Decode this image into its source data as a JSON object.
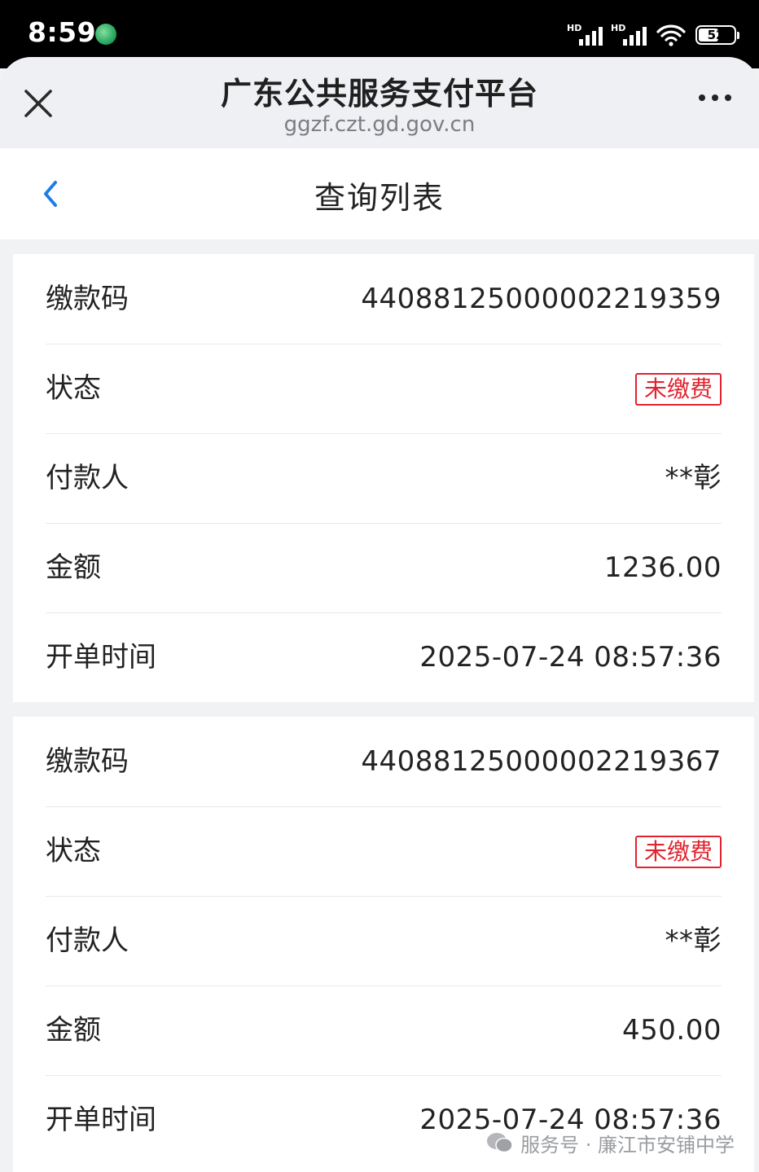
{
  "status_bar": {
    "time": "8:59",
    "battery": "52"
  },
  "browser": {
    "title": "广东公共服务支付平台",
    "url": "ggzf.czt.gd.gov.cn"
  },
  "page": {
    "title": "查询列表"
  },
  "labels": {
    "code": "缴款码",
    "status": "状态",
    "payer": "付款人",
    "amount": "金额",
    "time": "开单时间"
  },
  "records": [
    {
      "code": "440881250000022193​59",
      "status": "未缴费",
      "payer": "**彰",
      "amount": "1236.00",
      "time": "2025-07-24 08:57:36"
    },
    {
      "code": "44088125000002219367",
      "status": "未缴费",
      "payer": "**彰",
      "amount": "450.00",
      "time": "2025-07-24 08:57:36"
    }
  ],
  "watermark": {
    "text": "服务号 · 廉江市安铺中学"
  },
  "colors": {
    "status_unpaid": "#e1232f",
    "accent": "#1e7bea"
  }
}
